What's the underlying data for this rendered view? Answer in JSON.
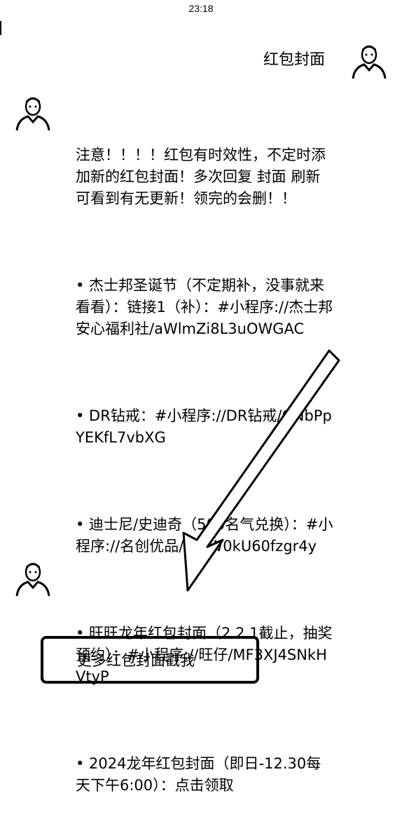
{
  "status_bar": {
    "time": "23:18"
  },
  "my_message": {
    "text": "红包封面"
  },
  "reply": {
    "paragraphs": [
      "注意！！！！红包有时效性，不定时添加新的红包封面！多次回复 封面 刷新可看到有无更新！领完的会删！！",
      "• 杰士邦圣诞节（不定期补，没事就来看看）：链接1（补）：#小程序://杰士邦安心福利社/aWlmZi8L3uOWGAC",
      "• DR钻戒：#小程序://DR钻戒/GNbPpYEKfL7vbXG",
      "• 迪士尼/史迪奇（500名气兑换）：#小程序://名创优品/DaJW0kU60fzgr4y",
      "• 旺旺龙年红包封面（2.2.1截止，抽奖预约）：#小程序://旺仔/MF3XJ4SNkHVtyP",
      "• 2024龙年红包封面（即日-12.30每天下午6:00）：点击领取"
    ]
  },
  "cta": {
    "label": "更多红包封面戳我"
  },
  "icons": {
    "my_avatar": "person-avatar-icon",
    "bot_avatar": "person-avatar-icon",
    "annotation": "arrow-down-left-icon"
  }
}
